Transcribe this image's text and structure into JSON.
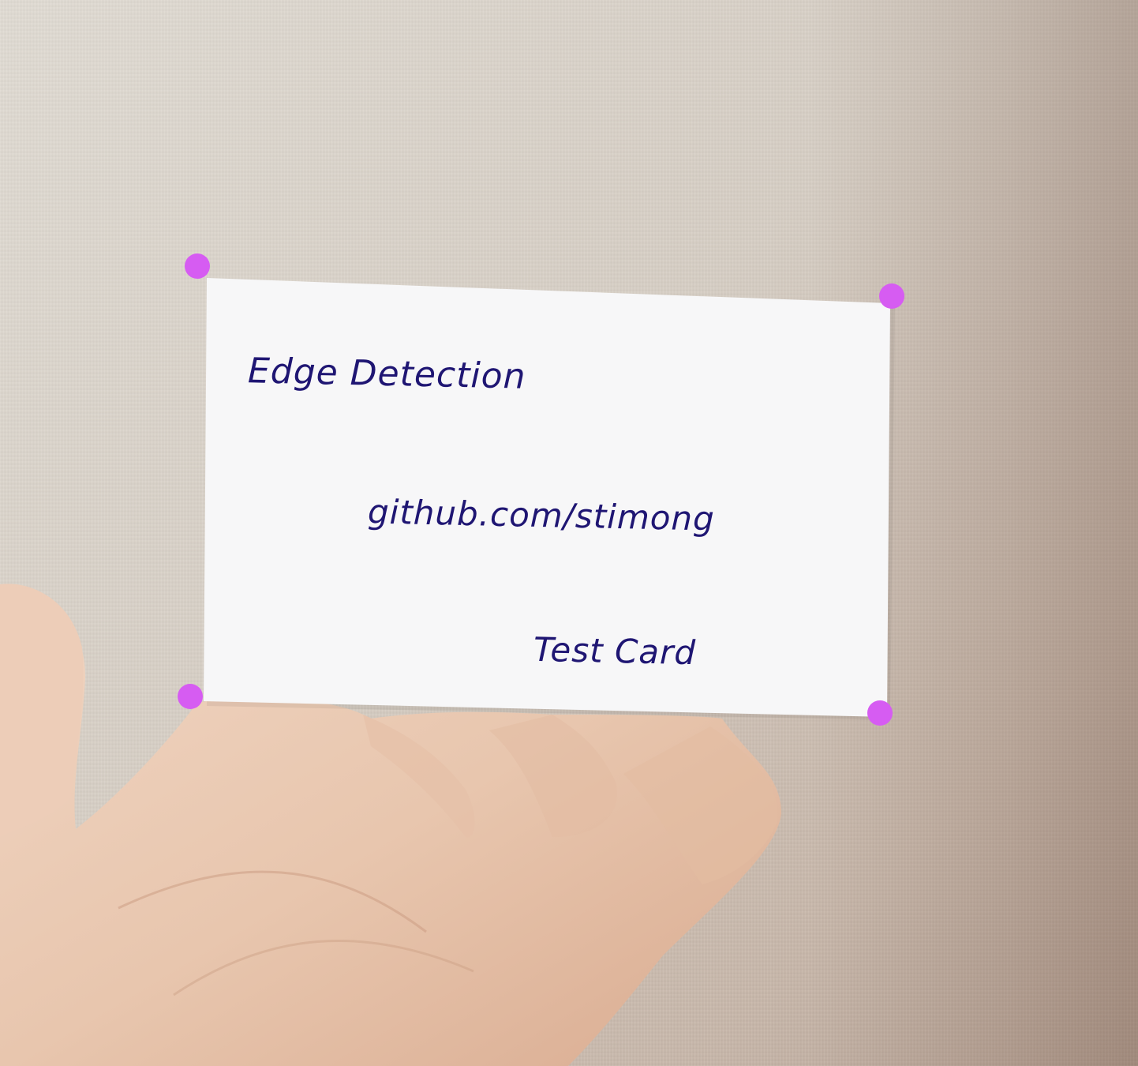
{
  "card": {
    "title": "Edge Detection",
    "url": "github.com/stimong",
    "subtitle": "Test Card"
  },
  "colors": {
    "marker": "#d65cf2",
    "ink": "#1f1673",
    "paper": "#f7f7f8",
    "wall": "#d9d1c8",
    "skin": "#e9c9b2"
  },
  "markers": [
    {
      "name": "corner-marker-top-left"
    },
    {
      "name": "corner-marker-top-right"
    },
    {
      "name": "corner-marker-bottom-left"
    },
    {
      "name": "corner-marker-bottom-right"
    }
  ]
}
